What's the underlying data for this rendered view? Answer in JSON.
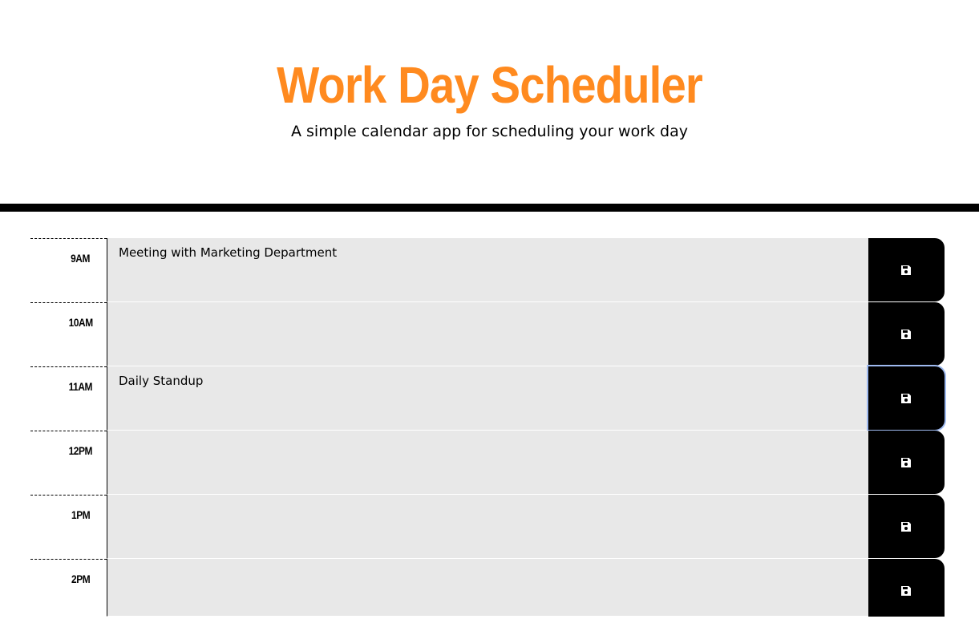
{
  "header": {
    "title": "Work Day Scheduler",
    "lead": "A simple calendar app for scheduling your work day"
  },
  "colors": {
    "title": "#ff8a1f",
    "row_bg": "#e8e8e8",
    "save_bg": "#000000"
  },
  "schedule": [
    {
      "hour": "9AM",
      "text": "Meeting with Marketing Department"
    },
    {
      "hour": "10AM",
      "text": ""
    },
    {
      "hour": "11AM",
      "text": "Daily Standup"
    },
    {
      "hour": "12PM",
      "text": ""
    },
    {
      "hour": "1PM",
      "text": ""
    },
    {
      "hour": "2PM",
      "text": ""
    }
  ],
  "save_icon": "floppy-disk-icon"
}
